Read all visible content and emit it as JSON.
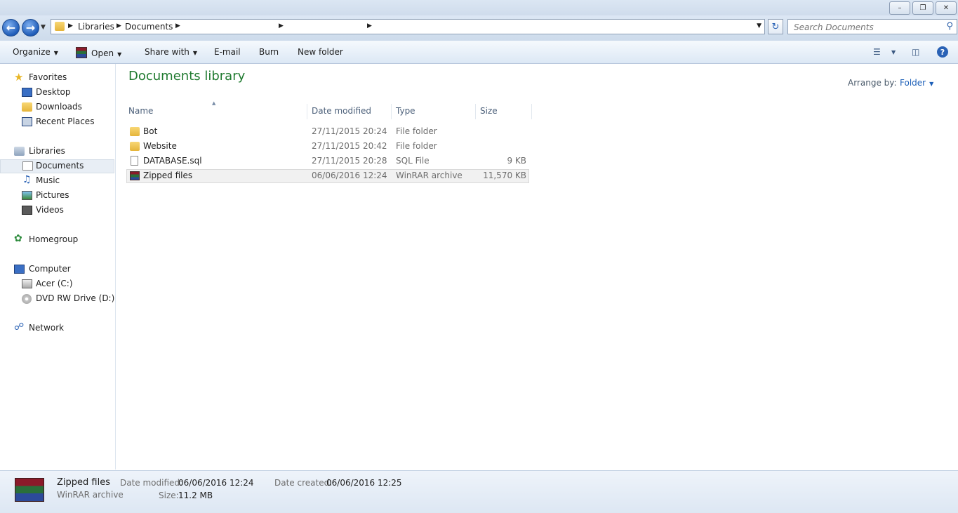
{
  "address": {
    "crumbs": [
      "Libraries",
      "Documents"
    ]
  },
  "search": {
    "placeholder": "Search Documents"
  },
  "toolbar": {
    "organize": "Organize",
    "open": "Open",
    "share_with": "Share with",
    "email": "E-mail",
    "burn": "Burn",
    "new_folder": "New folder"
  },
  "sidebar": {
    "favorites": {
      "label": "Favorites",
      "items": [
        "Desktop",
        "Downloads",
        "Recent Places"
      ]
    },
    "libraries": {
      "label": "Libraries",
      "items": [
        "Documents",
        "Music",
        "Pictures",
        "Videos"
      ]
    },
    "homegroup": "Homegroup",
    "computer": {
      "label": "Computer",
      "items": [
        "Acer (C:)",
        "DVD RW Drive (D:) Fe"
      ]
    },
    "network": "Network"
  },
  "main": {
    "title": "Documents library",
    "arrange_label": "Arrange by:",
    "arrange_value": "Folder",
    "columns": [
      "Name",
      "Date modified",
      "Type",
      "Size"
    ],
    "files": [
      {
        "name": "Bot",
        "date": "27/11/2015 20:24",
        "type": "File folder",
        "size": "",
        "icon": "folder-icon"
      },
      {
        "name": "Website",
        "date": "27/11/2015 20:42",
        "type": "File folder",
        "size": "",
        "icon": "folder-icon"
      },
      {
        "name": "DATABASE.sql",
        "date": "27/11/2015 20:28",
        "type": "SQL File",
        "size": "9 KB",
        "icon": "document-icon"
      },
      {
        "name": "Zipped files",
        "date": "06/06/2016 12:24",
        "type": "WinRAR archive",
        "size": "11,570 KB",
        "icon": "winrar-icon"
      }
    ]
  },
  "details": {
    "name": "Zipped files",
    "type": "WinRAR archive",
    "date_modified_label": "Date modified:",
    "date_modified": "06/06/2016 12:24",
    "size_label": "Size:",
    "size": "11.2 MB",
    "date_created_label": "Date created:",
    "date_created": "06/06/2016 12:25"
  },
  "colors": {
    "title_green": "#1f7a2f",
    "link_blue": "#1c5fb8",
    "selection_gray": "#f1f1f1"
  }
}
